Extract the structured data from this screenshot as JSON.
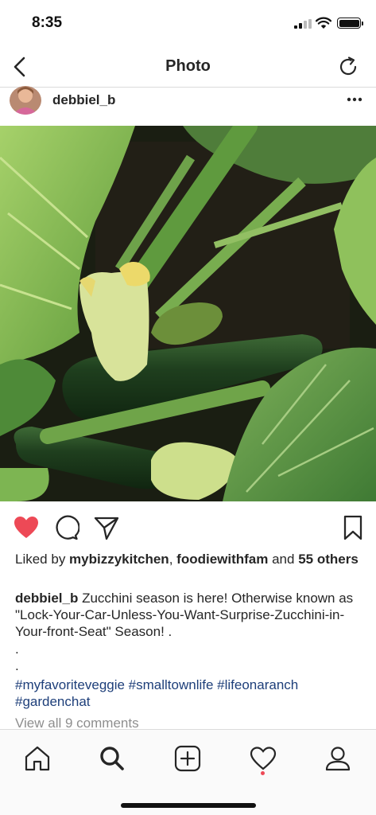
{
  "status_bar": {
    "time": "8:35"
  },
  "nav": {
    "title": "Photo"
  },
  "post": {
    "username": "debbiel_b",
    "likes": {
      "prefix": "Liked by ",
      "user1": "mybizzykitchen",
      "sep": ", ",
      "user2": "foodiewithfam",
      "and": " and ",
      "others": "55 others"
    },
    "caption": {
      "username": "debbiel_b",
      "text": " Zucchini season is here! Otherwise known as \"Lock-Your-Car-Unless-You-Want-Surprise-Zucchini-in-Your-front-Seat\" Season! .",
      "dot1": ".",
      "dot2": ".",
      "hashtags": "#myfavoriteveggie #smalltownlife #lifeonaranch #gardenchat"
    },
    "view_comments": "View all 9 comments"
  },
  "colors": {
    "like_red": "#ed4956",
    "hashtag_blue": "#1e3f7a",
    "muted": "#8e8e8e"
  },
  "icons": [
    "back-icon",
    "refresh-icon",
    "more-icon",
    "heart-icon",
    "comment-icon",
    "share-icon",
    "bookmark-icon",
    "home-icon",
    "search-icon",
    "add-icon",
    "activity-icon",
    "profile-icon"
  ]
}
